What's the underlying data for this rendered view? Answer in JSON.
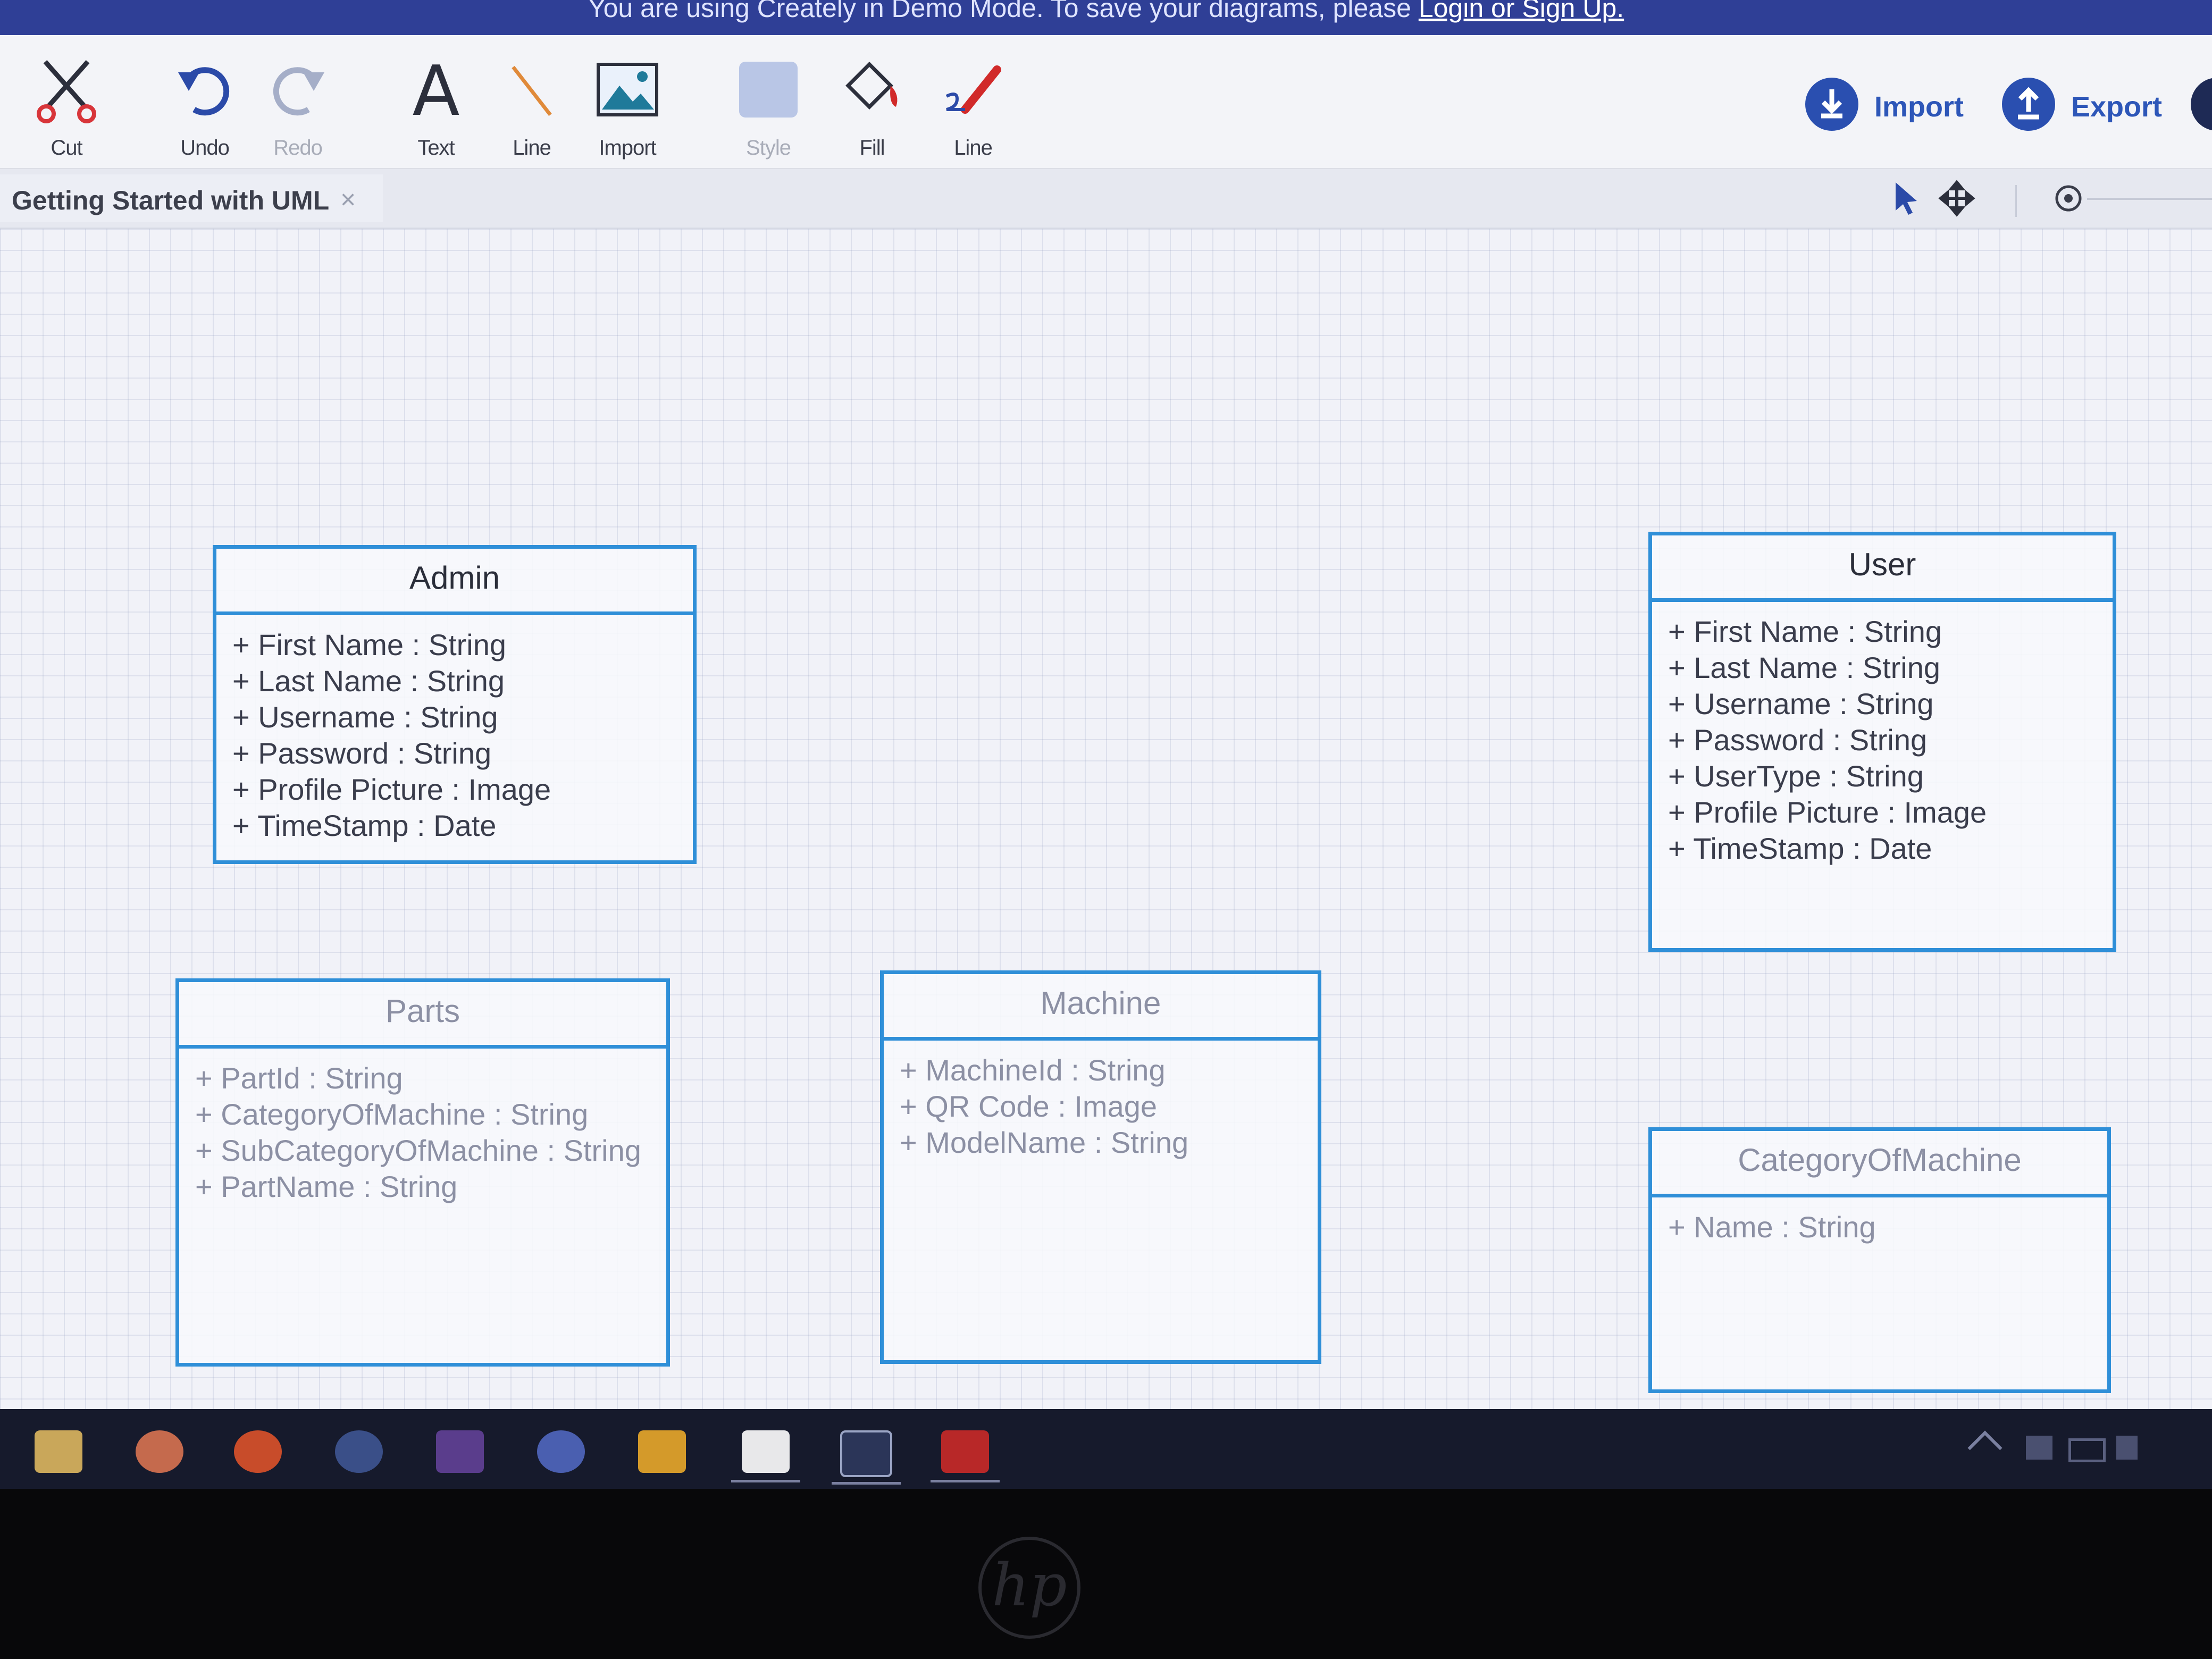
{
  "banner": {
    "text": "You are using Creately in Demo Mode. To save your diagrams, please",
    "link": "Login or Sign Up."
  },
  "toolbar": {
    "tools": [
      {
        "label": "Cut",
        "icon": "scissors-icon"
      },
      {
        "label": "Undo",
        "icon": "undo-icon"
      },
      {
        "label": "Redo",
        "icon": "redo-icon"
      },
      {
        "label": "Text",
        "icon": "text-icon"
      },
      {
        "label": "Line",
        "icon": "line-icon"
      },
      {
        "label": "Import",
        "icon": "image-icon"
      },
      {
        "label": "Style",
        "icon": "style-icon"
      },
      {
        "label": "Fill",
        "icon": "fill-bucket-icon"
      },
      {
        "label": "Line",
        "icon": "line-color-icon"
      }
    ],
    "import_label": "Import",
    "export_label": "Export"
  },
  "tab": {
    "title": "Getting Started with UML",
    "close": "×"
  },
  "classes": {
    "admin": {
      "name": "Admin",
      "attributes": [
        "+ First Name : String",
        "+ Last Name : String",
        "+ Username : String",
        "+ Password : String",
        "+ Profile Picture : Image",
        "+ TimeStamp : Date"
      ]
    },
    "user": {
      "name": "User",
      "attributes": [
        "+ First Name : String",
        "+ Last Name : String",
        "+ Username : String",
        "+ Password : String",
        "+ UserType : String",
        "+ Profile Picture : Image",
        "+ TimeStamp : Date"
      ]
    },
    "parts": {
      "name": "Parts",
      "attributes": [
        "+ PartId : String",
        "+ CategoryOfMachine : String",
        "+ SubCategoryOfMachine : String",
        "+ PartName : String"
      ]
    },
    "machine": {
      "name": "Machine",
      "attributes": [
        "+ MachineId : String",
        "+ QR Code : Image",
        "+ ModelName : String"
      ]
    },
    "category": {
      "name": "CategoryOfMachine",
      "attributes": [
        "+ Name : String"
      ]
    }
  },
  "taskbar": {
    "apps": [
      "file-explorer-icon",
      "chrome-icon",
      "firefox-icon",
      "steam-icon",
      "ide-icon",
      "vpn-icon",
      "sublime-icon",
      "sticky-notes-icon",
      "terminal-icon",
      "acrobat-icon"
    ]
  },
  "colors": {
    "accent": "#2f8fd8",
    "banner": "#2f3f96",
    "button": "#2a4fb0"
  }
}
